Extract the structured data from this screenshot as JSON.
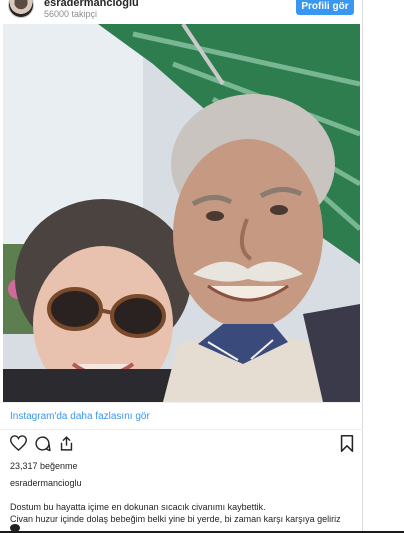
{
  "header": {
    "username": "esradermancioglu",
    "followers": "56000 takipçi",
    "profile_button": "Profili gör"
  },
  "post": {
    "more_link": "Instagram'da daha fazlasını gör",
    "likes": "23,317 beğenme",
    "author": "esradermancioglu",
    "caption_line1": "Dostum bu hayatta içime en dokunan sıcacık civanımı kaybettik.",
    "caption_line2": "Civan huzur içinde dolaş bebeğim belki yine bi yerde, bi zaman karşı karşıya geliriz",
    "photo_label": "selfie-photo"
  },
  "icons": {
    "like": "heart-icon",
    "comment": "comment-icon",
    "share": "share-icon",
    "save": "bookmark-icon",
    "emoji": "broken-heart-emoji"
  },
  "colors": {
    "accent": "#3897f0",
    "text": "#262626",
    "muted": "#8e8e8e"
  }
}
